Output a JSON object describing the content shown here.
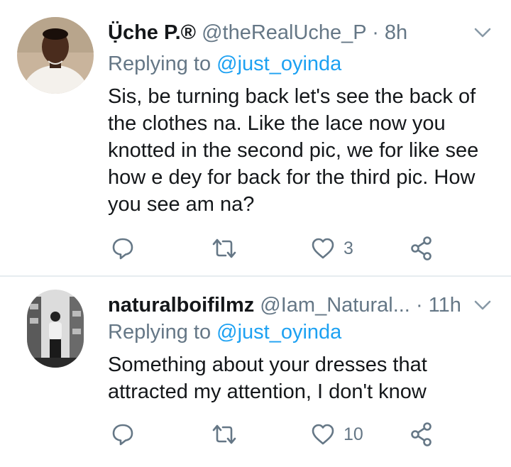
{
  "colors": {
    "accent": "#1da1f2",
    "muted": "#657786",
    "text": "#14171a",
    "divider": "#e6ecf0"
  },
  "tweets": [
    {
      "name": "Ụ̈che P.®",
      "handle": "@theRealUche_P",
      "separator": "·",
      "time": "8h",
      "replying_prefix": "Replying to",
      "replying_to": "@just_oyinda",
      "body": "Sis, be turning back let's see the back of the clothes na. Like the lace now you knotted in the second pic, we for like see how e dey for back for the third pic. How you see am na?",
      "actions": {
        "reply_icon": "reply-icon",
        "retweet_icon": "retweet-icon",
        "like_icon": "heart-icon",
        "like_count": "3",
        "share_icon": "share-icon"
      }
    },
    {
      "name": "naturalboifilmz",
      "handle": "@Iam_Natural...",
      "separator": "·",
      "time": "11h",
      "replying_prefix": "Replying to",
      "replying_to": "@just_oyinda",
      "body": "Something about your dresses that attracted my attention,  I don't know",
      "actions": {
        "reply_icon": "reply-icon",
        "retweet_icon": "retweet-icon",
        "like_icon": "heart-icon",
        "like_count": "10",
        "share_icon": "share-icon"
      }
    }
  ]
}
